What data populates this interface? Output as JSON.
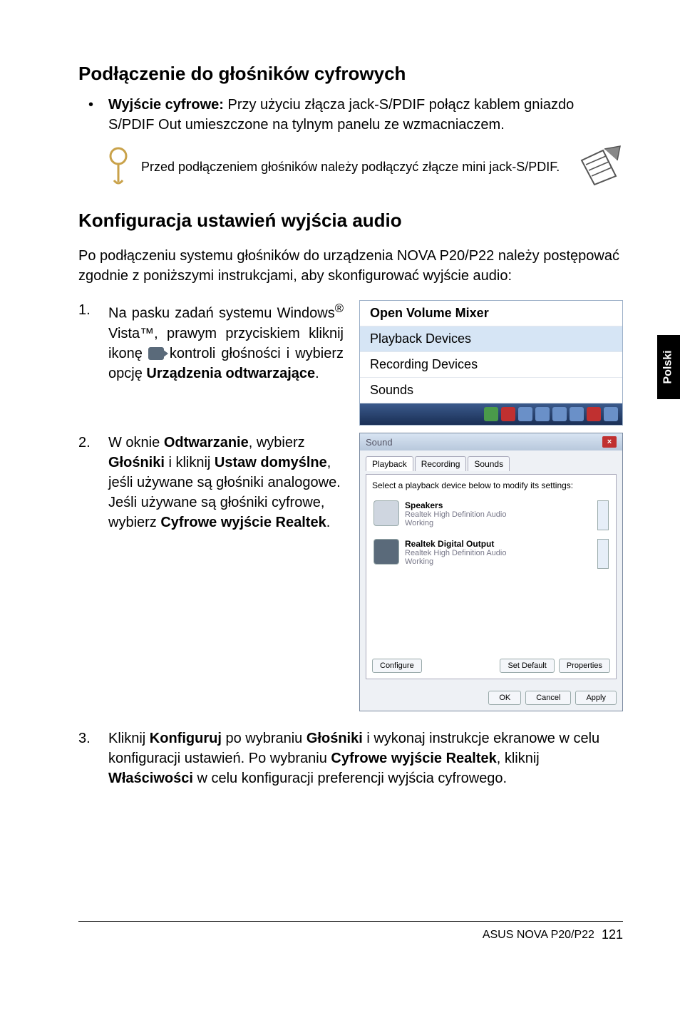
{
  "h1": "Podłączenie do głośników cyfrowych",
  "bullet": {
    "lead": "Wyjście cyfrowe:",
    "text": " Przy użyciu złącza jack-S/PDIF połącz kablem gniazdo S/PDIF Out umieszczone na tylnym panelu ze wzmacniaczem."
  },
  "note": "Przed podłączeniem głośników należy podłączyć złącze mini jack-S/PDIF.",
  "h2": "Konfiguracja ustawień wyjścia audio",
  "intro": "Po podłączeniu systemu głośników do urządzenia NOVA P20/P22 należy postępować zgodnie z poniższymi instrukcjami, aby skonfigurować wyjście audio:",
  "steps": {
    "s1": {
      "num": "1.",
      "a": "Na pasku zadań systemu Windows",
      "reg": "®",
      "b": " Vista™, prawym przyciskiem kliknij ikonę ",
      "c": " kontroli głośności i wybierz opcję ",
      "d": "Urządzenia odtwarzające",
      "e": "."
    },
    "s2": {
      "num": "2.",
      "a": "W oknie ",
      "b": "Odtwarzanie",
      "c": ", wybierz ",
      "d": "Głośniki",
      "e": " i kliknij ",
      "f": "Ustaw domyślne",
      "g": ", jeśli używane są głośniki analogowe. Jeśli używane są głośniki cyfrowe, wybierz ",
      "h": "Cyfrowe wyjście Realtek",
      "i": "."
    },
    "s3": {
      "num": "3.",
      "a": "Kliknij ",
      "b": "Konfiguruj",
      "c": " po wybraniu ",
      "d": "Głośniki",
      "e": " i wykonaj instrukcje ekranowe w celu konfiguracji ustawień. Po wybraniu ",
      "f": "Cyfrowe wyjście Realtek",
      "g": ", kliknij ",
      "h": "Właściwości",
      "i": " w celu konfiguracji preferencji wyjścia cyfrowego."
    }
  },
  "menu1": {
    "i1": "Open Volume Mixer",
    "i2": "Playback Devices",
    "i3": "Recording Devices",
    "i4": "Sounds"
  },
  "dlg": {
    "title": "Sound",
    "tabs": {
      "t1": "Playback",
      "t2": "Recording",
      "t3": "Sounds"
    },
    "hint": "Select a playback device below to modify its settings:",
    "dev1": {
      "t": "Speakers",
      "s1": "Realtek High Definition Audio",
      "s2": "Working"
    },
    "dev2": {
      "t": "Realtek Digital Output",
      "s1": "Realtek High Definition Audio",
      "s2": "Working"
    },
    "btns": {
      "conf": "Configure",
      "def": "Set Default",
      "prop": "Properties",
      "ok": "OK",
      "cancel": "Cancel",
      "apply": "Apply"
    }
  },
  "sidetab": "Polski",
  "footer": {
    "model": "ASUS NOVA P20/P22",
    "page": "121"
  }
}
